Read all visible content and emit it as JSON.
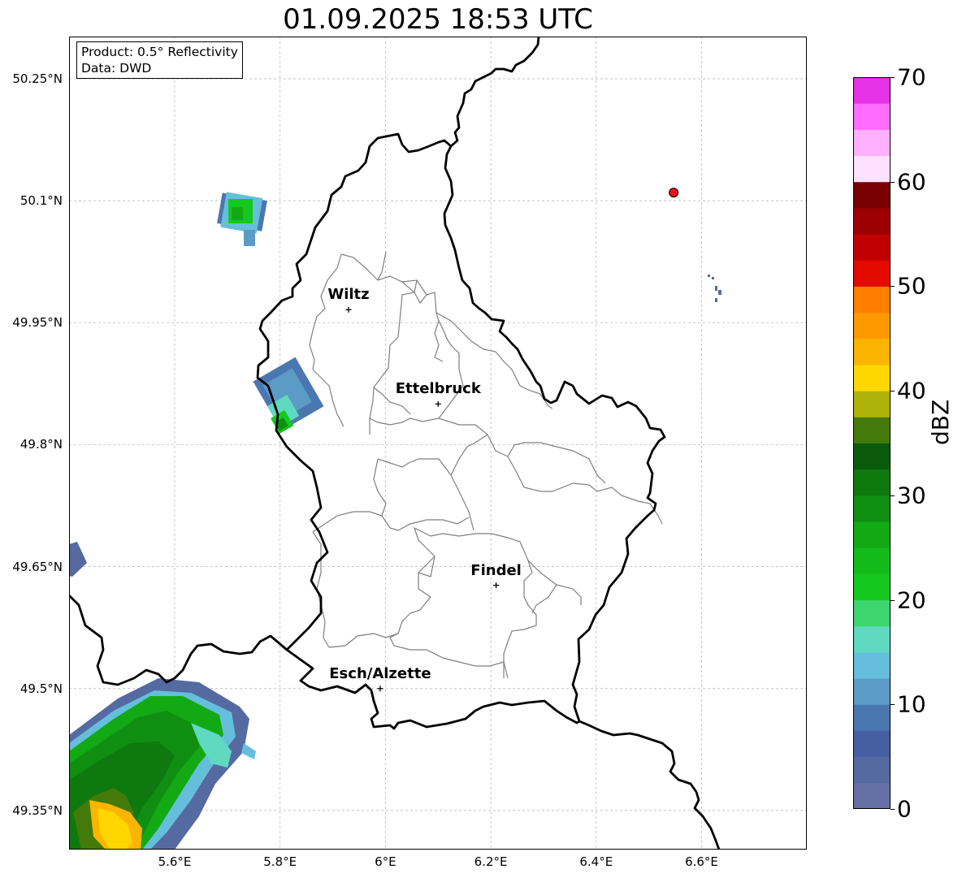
{
  "title": "01.09.2025 18:53 UTC",
  "info": {
    "product": "Product: 0.5° Reflectivity",
    "source": "Data: DWD"
  },
  "lat_ticks": [
    "50.25°N",
    "50.1°N",
    "49.95°N",
    "49.8°N",
    "49.65°N",
    "49.5°N",
    "49.35°N"
  ],
  "lon_ticks": [
    "5.6°E",
    "5.8°E",
    "6°E",
    "6.2°E",
    "6.4°E",
    "6.6°E"
  ],
  "cities": [
    {
      "name": "Wiltz",
      "lon": 5.93,
      "lat": 49.966
    },
    {
      "name": "Ettelbruck",
      "lon": 6.1,
      "lat": 49.85
    },
    {
      "name": "Findel",
      "lon": 6.21,
      "lat": 49.627
    },
    {
      "name": "Esch/Alzette",
      "lon": 5.99,
      "lat": 49.5
    }
  ],
  "station_marker": {
    "lon": 6.547,
    "lat": 50.11,
    "color": "#e8141c"
  },
  "colorbar": {
    "label": "dBZ",
    "min": 0,
    "max": 70,
    "step": 2.5,
    "ticks": [
      "0",
      "10",
      "20",
      "30",
      "40",
      "50",
      "60",
      "70"
    ],
    "colors": [
      "#6571a5",
      "#566aa2",
      "#465fa2",
      "#4b77b0",
      "#5b9bc6",
      "#65bfdc",
      "#60d9c1",
      "#3dd56e",
      "#14c81e",
      "#12bb1a",
      "#13a915",
      "#108e12",
      "#0d790e",
      "#0b5a0c",
      "#447a0a",
      "#aeb20a",
      "#ffd700",
      "#fbb500",
      "#fe9a00",
      "#ff7f00",
      "#e30a00",
      "#c00000",
      "#9c0000",
      "#780000",
      "#ffe0ff",
      "#ffb0ff",
      "#ff6cff",
      "#e733e8"
    ]
  },
  "colors": {
    "country_border": "#000000",
    "canton_border": "#7f7f7f",
    "grid": "#b0b0b0"
  }
}
